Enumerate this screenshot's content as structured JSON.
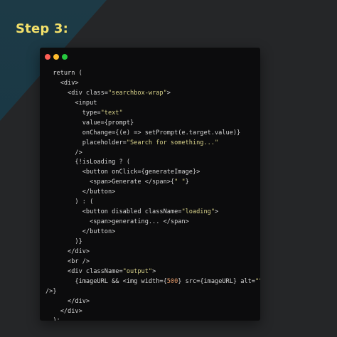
{
  "step_title": "Step 3:",
  "colors": {
    "background": "#252628",
    "accent_teal": "#1a3b48",
    "title": "#f3e06a",
    "editor_bg": "#0c0c0d",
    "dot_red": "#ff5f56",
    "dot_yellow": "#ffbd2e",
    "dot_green": "#27c93f",
    "code_default": "#d6d6d6",
    "code_string": "#d8d28a",
    "code_number": "#e49a6a"
  },
  "window_controls": [
    {
      "icon": "close-dot-icon",
      "color": "#ff5f56"
    },
    {
      "icon": "minimize-dot-icon",
      "color": "#ffbd2e"
    },
    {
      "icon": "maximize-dot-icon",
      "color": "#27c93f"
    }
  ],
  "code_lines": [
    [
      {
        "t": "  return ("
      }
    ],
    [
      {
        "t": "    <div>"
      }
    ],
    [
      {
        "t": "      <div class="
      },
      {
        "t": "\"searchbox-wrap\"",
        "c": "string"
      },
      {
        "t": ">"
      }
    ],
    [
      {
        "t": "        <input"
      }
    ],
    [
      {
        "t": "          type="
      },
      {
        "t": "\"text\"",
        "c": "string"
      }
    ],
    [
      {
        "t": "          value={prompt}"
      }
    ],
    [
      {
        "t": "          onChange={(e) => setPrompt(e.target.value)}"
      }
    ],
    [
      {
        "t": "          placeholder="
      },
      {
        "t": "\"Search for something...\"",
        "c": "string"
      }
    ],
    [
      {
        "t": "        />"
      }
    ],
    [
      {
        "t": "        {!isLoading ? ("
      }
    ],
    [
      {
        "t": "          <button onClick={generateImage}>"
      }
    ],
    [
      {
        "t": "            <span>Generate </span>{"
      },
      {
        "t": "\" \"",
        "c": "string"
      },
      {
        "t": "}"
      }
    ],
    [
      {
        "t": "          </button>"
      }
    ],
    [
      {
        "t": "        ) : ("
      }
    ],
    [
      {
        "t": "          <button disabled className="
      },
      {
        "t": "\"loading\"",
        "c": "string"
      },
      {
        "t": ">"
      }
    ],
    [
      {
        "t": "            <span>generating... </span>"
      }
    ],
    [
      {
        "t": "          </button>"
      }
    ],
    [
      {
        "t": "        )}"
      }
    ],
    [
      {
        "t": "      </div>"
      }
    ],
    [
      {
        "t": "      <br />"
      }
    ],
    [
      {
        "t": "      <div className="
      },
      {
        "t": "\"output\"",
        "c": "string"
      },
      {
        "t": ">"
      }
    ],
    [
      {
        "t": "        {imageURL && <img width={"
      },
      {
        "t": "500",
        "c": "number"
      },
      {
        "t": "} src={imageURL} alt="
      },
      {
        "t": "\"\"",
        "c": "string"
      }
    ],
    [
      {
        "t": "/>}"
      }
    ],
    [
      {
        "t": "      </div>"
      }
    ],
    [
      {
        "t": "    </div>"
      }
    ],
    [
      {
        "t": "  );"
      }
    ]
  ]
}
